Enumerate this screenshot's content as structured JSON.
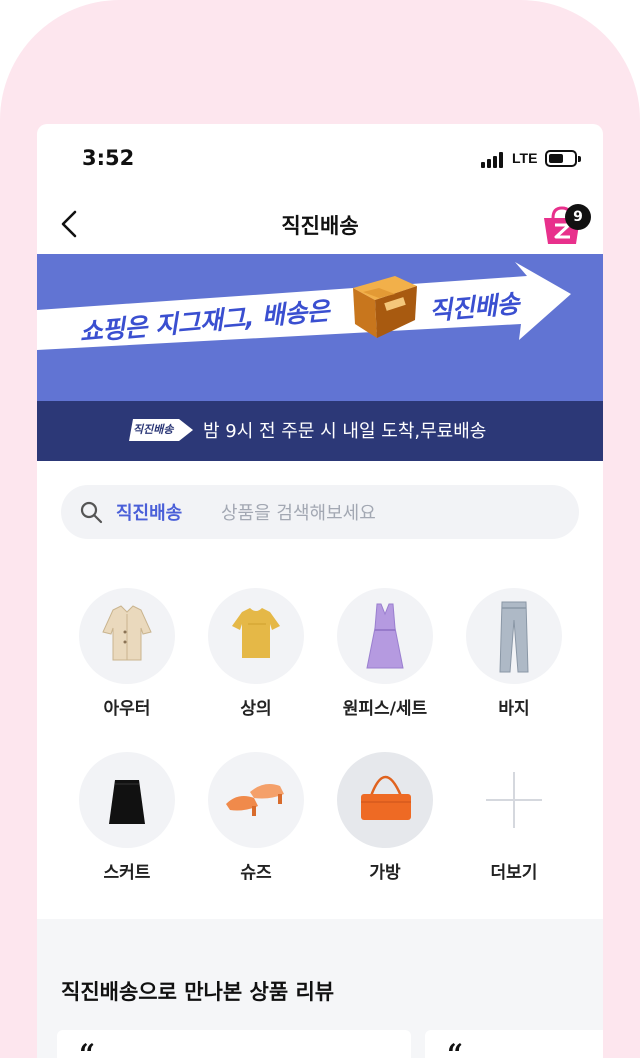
{
  "status_bar": {
    "time": "3:52",
    "network": "LTE"
  },
  "nav": {
    "title": "직진배송",
    "cart_count": "9",
    "cart_accent": "#e8308c"
  },
  "banner": {
    "text_left": "쇼핑은 지그재그, 배송은",
    "text_right": "직진배송",
    "background": "#6174d3"
  },
  "promo": {
    "tag": "직진배송",
    "text": "밤 9시 전 주문 시 내일 도착,무료배송"
  },
  "search": {
    "highlight": "직진배송",
    "placeholder": "상품을 검색해보세요"
  },
  "categories": [
    {
      "label": "아우터",
      "icon": "outer-jacket-icon"
    },
    {
      "label": "상의",
      "icon": "top-tshirt-icon"
    },
    {
      "label": "원피스/세트",
      "icon": "dress-icon"
    },
    {
      "label": "바지",
      "icon": "pants-icon"
    },
    {
      "label": "스커트",
      "icon": "skirt-icon"
    },
    {
      "label": "슈즈",
      "icon": "shoes-icon"
    },
    {
      "label": "가방",
      "icon": "bag-icon"
    },
    {
      "label": "더보기",
      "icon": "plus-icon"
    }
  ],
  "reviews": {
    "title": "직진배송으로 만나본 상품 리뷰",
    "quote_left": "“",
    "quote_right": "“"
  }
}
